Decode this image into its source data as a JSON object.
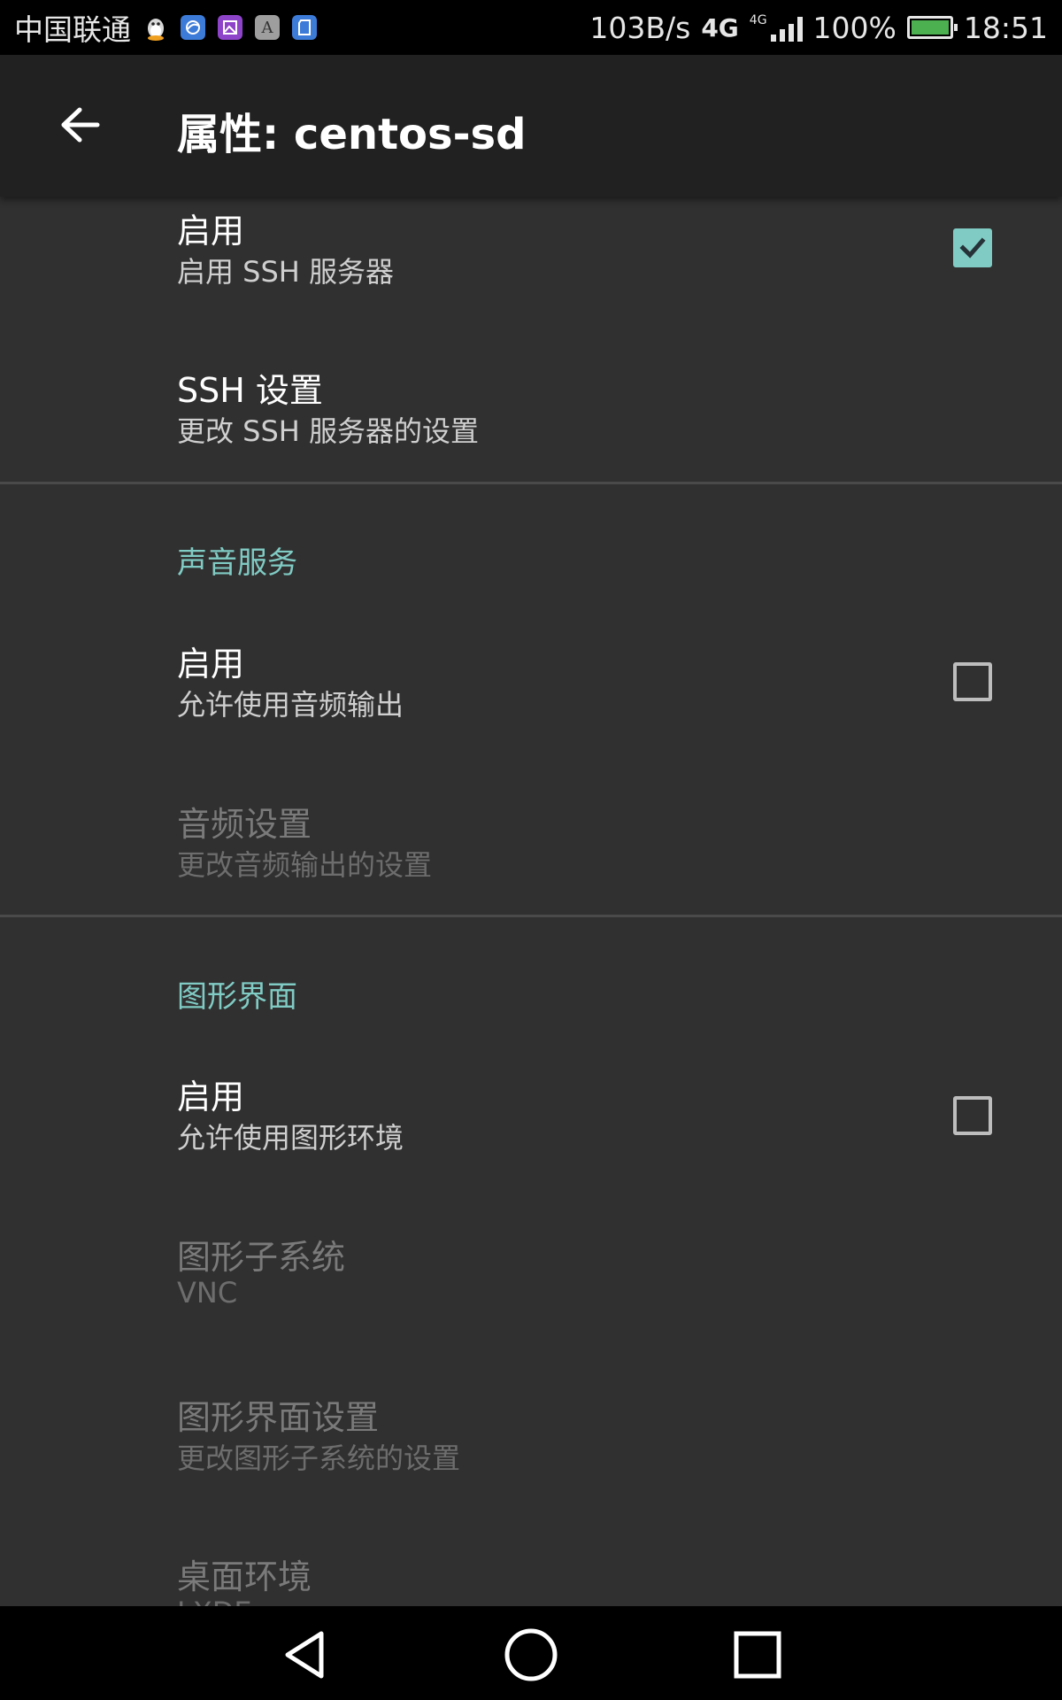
{
  "status_bar": {
    "carrier": "中国联通",
    "speed": "103B/s",
    "network": "4G",
    "network_small": "4G",
    "battery": "100%",
    "time": "18:51",
    "icons": [
      "qq-icon",
      "browser-icon",
      "gallery-icon",
      "font-icon",
      "sd-card-icon"
    ],
    "battery_color": "#4caf50"
  },
  "app_bar": {
    "title": "属性: centos-sd",
    "back_icon": "arrow-left-icon"
  },
  "accent_color": "#80cbc4",
  "ssh": {
    "enable_title": "启用",
    "enable_summary": "启用 SSH 服务器",
    "enable_checked": true,
    "settings_title": "SSH 设置",
    "settings_summary": "更改 SSH 服务器的设置"
  },
  "audio": {
    "category": "声音服务",
    "enable_title": "启用",
    "enable_summary": "允许使用音频输出",
    "enable_checked": false,
    "settings_title": "音频设置",
    "settings_summary": "更改音频输出的设置"
  },
  "graphics": {
    "category": "图形界面",
    "enable_title": "启用",
    "enable_summary": "允许使用图形环境",
    "enable_checked": false,
    "subsystem_title": "图形子系统",
    "subsystem_value": "VNC",
    "settings_title": "图形界面设置",
    "settings_summary": "更改图形子系统的设置",
    "desktop_title": "桌面环境",
    "desktop_value": "LXDE"
  },
  "nav_bar": {
    "back": "back-triangle-icon",
    "home": "home-circle-icon",
    "recents": "recents-square-icon"
  }
}
